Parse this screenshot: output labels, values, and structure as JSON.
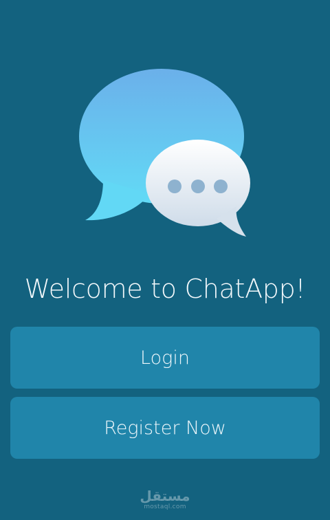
{
  "welcome": {
    "title": "Welcome to ChatApp!"
  },
  "actions": {
    "login_label": "Login",
    "register_label": "Register Now"
  },
  "watermark": {
    "arabic_text": "مستقل",
    "latin_text": "mostaql.com"
  },
  "logo": {
    "icon": "chat-bubbles-icon",
    "typing_dots": 3
  },
  "colors": {
    "background": "#13627f",
    "button": "#2085aa",
    "bubble_top": "#6bb0ea",
    "bubble_bottom": "#62d8f5"
  }
}
